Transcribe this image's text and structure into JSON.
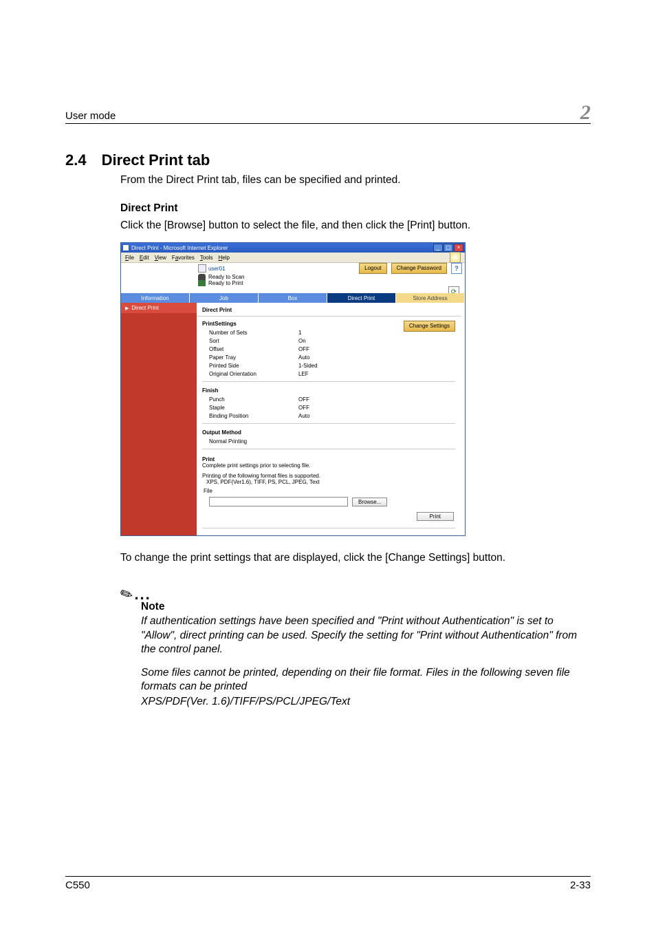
{
  "running_head": {
    "left": "User mode",
    "right": "2"
  },
  "section": {
    "num": "2.4",
    "title": "Direct Print tab"
  },
  "intro": "From the Direct Print tab, files can be specified and printed.",
  "sub_head": "Direct Print",
  "sub_intro": "Click the [Browse] button to select the file, and then click the [Print] button.",
  "ie": {
    "title": "Direct Print - Microsoft Internet Explorer",
    "menu": {
      "file": "File",
      "edit": "Edit",
      "view": "View",
      "favorites": "Favorites",
      "tools": "Tools",
      "help": "Help"
    }
  },
  "app": {
    "user": "user01",
    "logout": "Logout",
    "change_pw": "Change Password",
    "help_icon": "?",
    "status_scan": "Ready to Scan",
    "status_print": "Ready to Print",
    "refresh_icon": "⟳",
    "tabs": {
      "info": "Information",
      "job": "Job",
      "box": "Box",
      "dp": "Direct Print",
      "sa": "Store Address"
    },
    "side_item": "Direct Print",
    "main_title": "Direct Print",
    "change_settings": "Change Settings",
    "sec_printsettings": "PrintSettings",
    "rows_ps": [
      {
        "lab": "Number of Sets",
        "val": "1"
      },
      {
        "lab": "Sort",
        "val": "On"
      },
      {
        "lab": "Offset",
        "val": "OFF"
      },
      {
        "lab": "Paper Tray",
        "val": "Auto"
      },
      {
        "lab": "Printed Side",
        "val": "1-Sided"
      },
      {
        "lab": "Original Orientation",
        "val": "LEF"
      }
    ],
    "sec_finish": "Finish",
    "rows_fin": [
      {
        "lab": "Punch",
        "val": "OFF"
      },
      {
        "lab": "Staple",
        "val": "OFF"
      },
      {
        "lab": "Binding Position",
        "val": "Auto"
      }
    ],
    "sec_output": "Output Method",
    "rows_out": [
      {
        "lab": "Normal Printing",
        "val": ""
      }
    ],
    "print_head": "Print",
    "print_note1": "Complete print settings prior to selecting file.",
    "print_note2": "Printing of the following format files is supported.",
    "print_note3": "XPS, PDF(Ver1.6), TIFF, PS, PCL, JPEG, Text",
    "file_label": "File",
    "browse": "Browse...",
    "print_btn": "Print"
  },
  "after": "To change the print settings that are displayed, click the [Change Settings] button.",
  "note_head": "Note",
  "note_p1": "If authentication settings have been specified and \"Print without Authentication\" is set to \"Allow\", direct printing can be used. Specify the setting for \"Print without Authentication\" from the control panel.",
  "note_p2": "Some files cannot be printed, depending on their file format. Files in the following seven file formats can be printed",
  "note_p3": "XPS/PDF(Ver. 1.6)/TIFF/PS/PCL/JPEG/Text",
  "footer": {
    "left": "C550",
    "right": "2-33"
  }
}
